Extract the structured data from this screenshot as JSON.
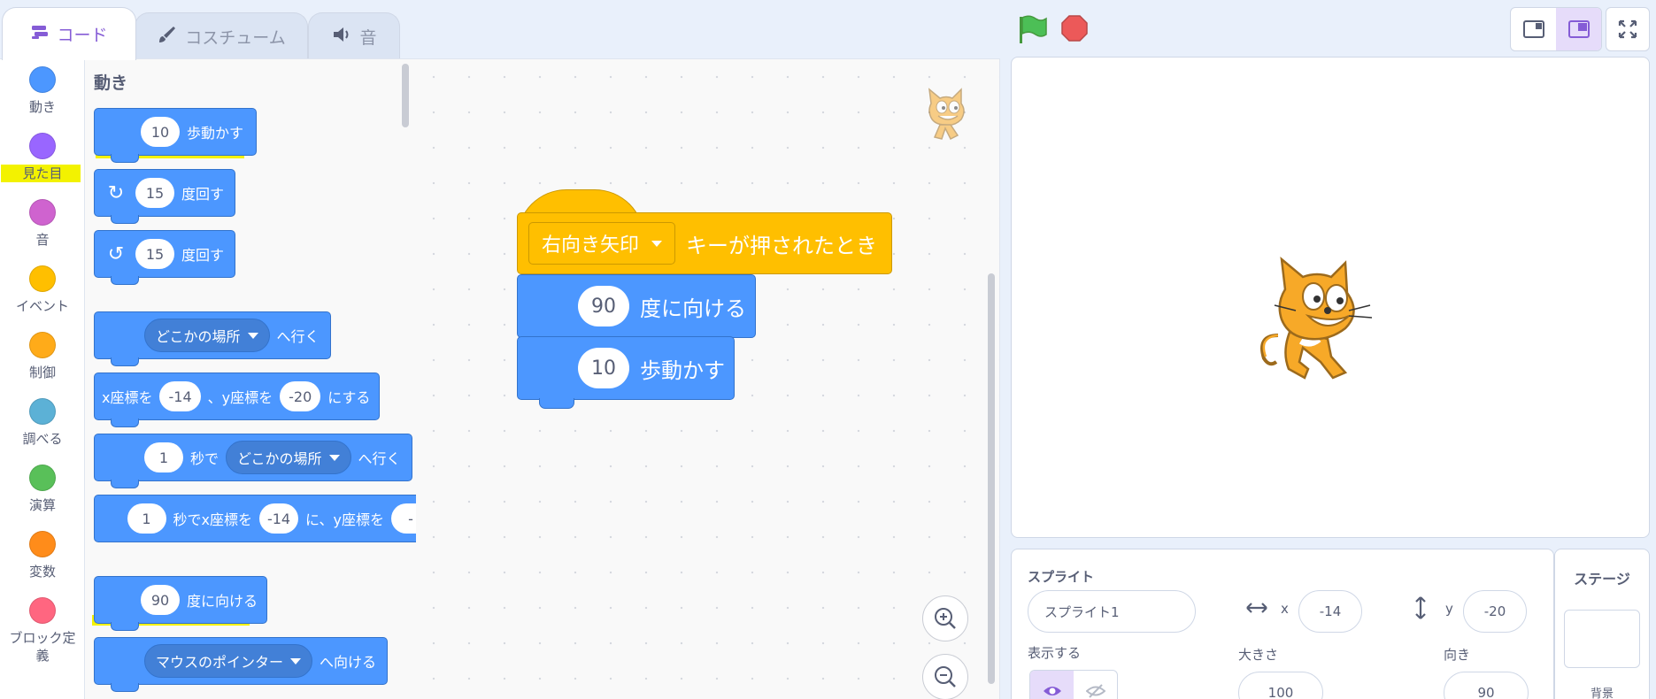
{
  "tabs": {
    "code": "コード",
    "costume": "コスチューム",
    "sound": "音"
  },
  "categories": [
    {
      "label": "動き",
      "color": "#4c97ff"
    },
    {
      "label": "見た目",
      "color": "#9966ff"
    },
    {
      "label": "音",
      "color": "#cf63cf"
    },
    {
      "label": "イベント",
      "color": "#ffbf00"
    },
    {
      "label": "制御",
      "color": "#ffab19"
    },
    {
      "label": "調べる",
      "color": "#5cb1d6"
    },
    {
      "label": "演算",
      "color": "#59c059"
    },
    {
      "label": "変数",
      "color": "#ff8c1a"
    },
    {
      "label": "ブロック定\n義",
      "color": "#ff6680"
    }
  ],
  "palette": {
    "title": "動き",
    "move": {
      "steps": "10",
      "text": "歩動かす"
    },
    "turn_right": {
      "degrees": "15",
      "text": "度回す"
    },
    "turn_left": {
      "degrees": "15",
      "text": "度回す"
    },
    "goto": {
      "target": "どこかの場所",
      "text": "へ行く"
    },
    "goto_xy": {
      "x_prefix": "x座標を",
      "x": "-14",
      "y_prefix": "、y座標を",
      "y": "-20",
      "suffix": "にする"
    },
    "glide_to": {
      "secs": "1",
      "secs_text": "秒で",
      "target": "どこかの場所",
      "text": "へ行く"
    },
    "glide_xy": {
      "secs": "1",
      "x_prefix": "秒でx座標を",
      "x": "-14",
      "y_prefix": "に、y座標を",
      "y": "-"
    },
    "point_dir": {
      "degrees": "90",
      "text": "度に向ける"
    },
    "point_towards": {
      "target": "マウスのポインター",
      "text": "へ向ける"
    }
  },
  "script": {
    "hat": {
      "key": "右向き矢印",
      "text": "キーが押されたとき"
    },
    "point_dir": {
      "degrees": "90",
      "text": "度に向ける"
    },
    "move": {
      "steps": "10",
      "text": "歩動かす"
    }
  },
  "sprite_info": {
    "sprite_label": "スプライト",
    "sprite_name": "スプライト1",
    "x_label": "x",
    "x_value": "-14",
    "y_label": "y",
    "y_value": "-20",
    "show_label": "表示する",
    "size_label": "大きさ",
    "size_value": "100",
    "direction_label": "向き",
    "direction_value": "90"
  },
  "stage_panel": {
    "title": "ステージ",
    "backdrop_label": "背景"
  },
  "colors": {
    "motion": "#4c97ff",
    "events": "#ffbf00",
    "accent": "#855cd6",
    "highlight": "#f3f200"
  }
}
